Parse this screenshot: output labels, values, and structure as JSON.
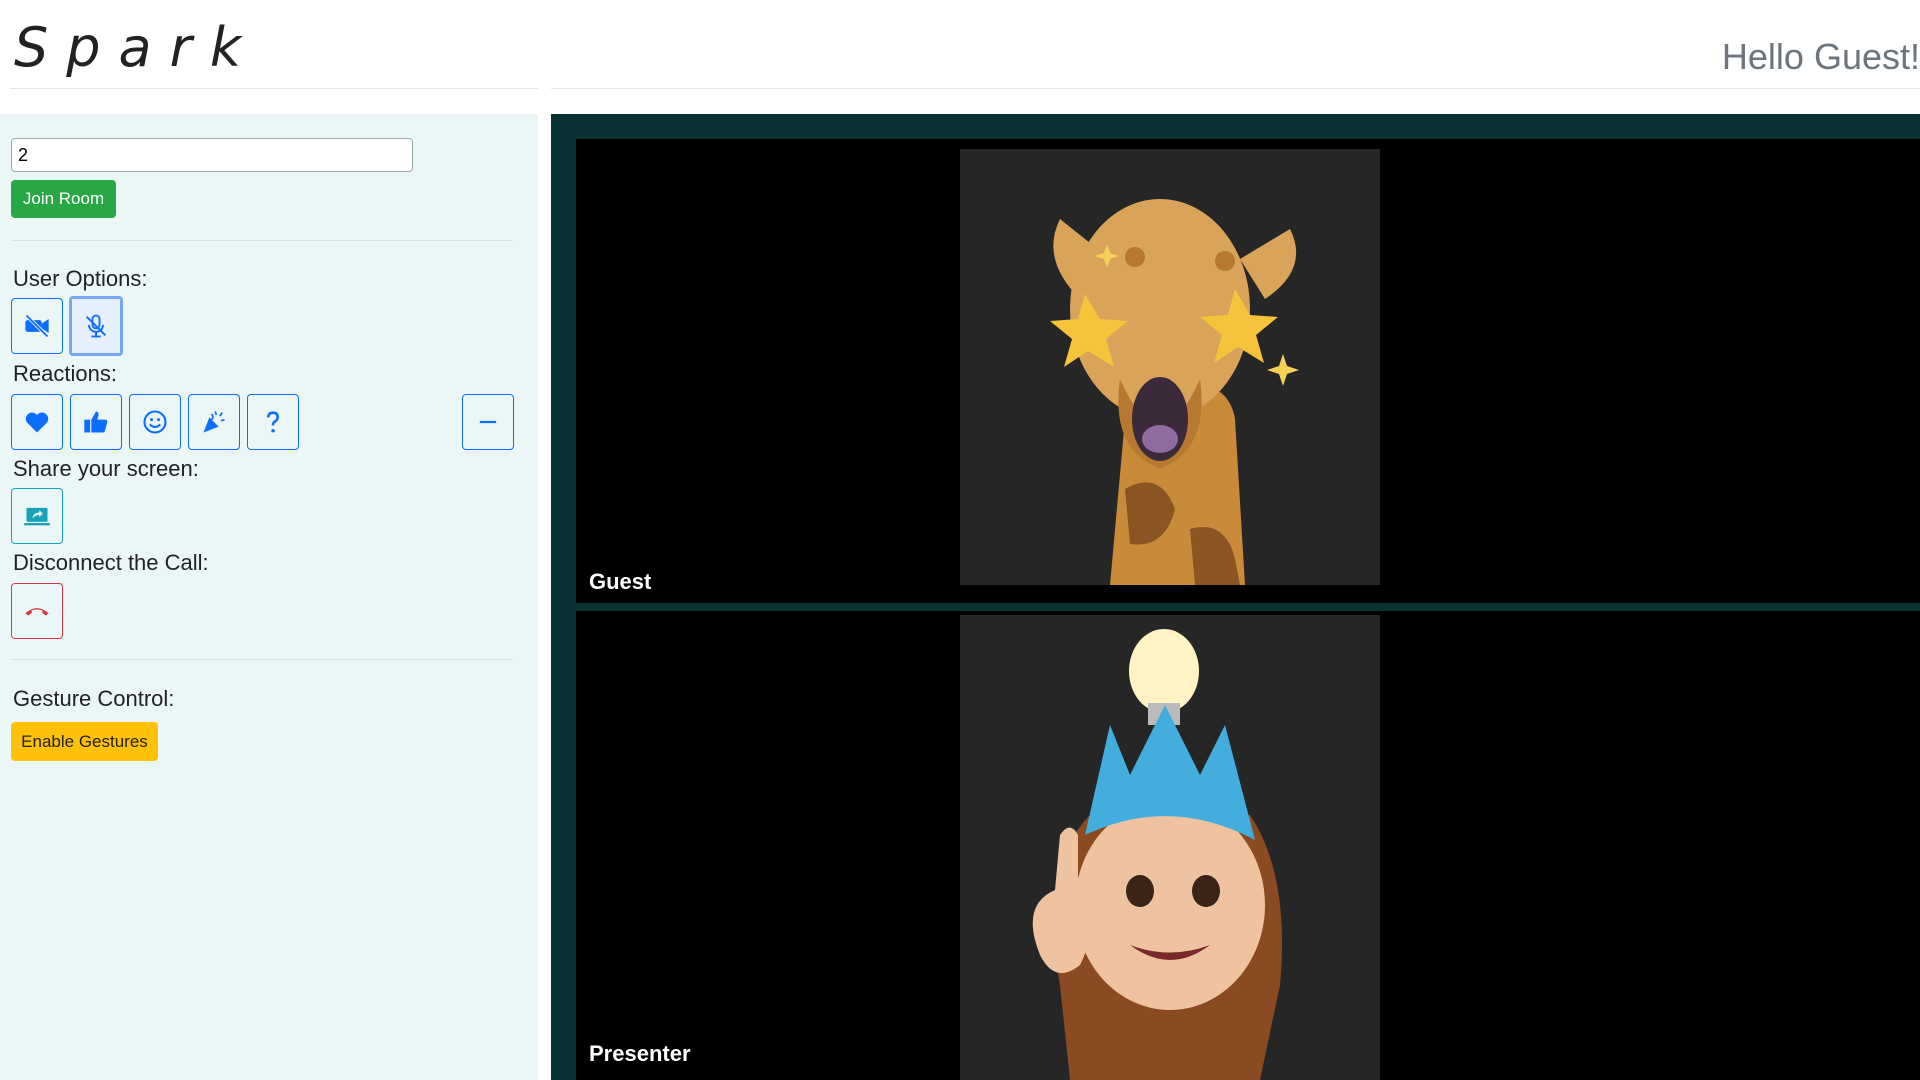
{
  "header": {
    "brand": "Spark",
    "greeting": "Hello Guest!"
  },
  "sidebar": {
    "room_input_value": "2",
    "join_label": "Join Room",
    "user_options_label": "User Options:",
    "reactions_label": "Reactions:",
    "share_label": "Share your screen:",
    "disconnect_label": "Disconnect the Call:",
    "gesture_label": "Gesture Control:",
    "gestures_button": "Enable Gestures",
    "icons": [
      "video-off-icon",
      "mic-off-icon",
      "heart-icon",
      "thumbs-up-icon",
      "smile-icon",
      "party-popper-icon",
      "question-icon",
      "minus-icon",
      "screen-share-icon",
      "hang-up-icon"
    ]
  },
  "stage": {
    "tiles": [
      {
        "label": "Guest",
        "avatar": "giraffe-memoji"
      },
      {
        "label": "Presenter",
        "avatar": "crowned-girl-memoji"
      }
    ]
  },
  "colors": {
    "accent": "#0d6efd",
    "join": "#28a745",
    "gestures": "#ffc107",
    "hangup": "#dc3545",
    "stage": "#0b3335",
    "sidebar": "#ebf7f7"
  }
}
